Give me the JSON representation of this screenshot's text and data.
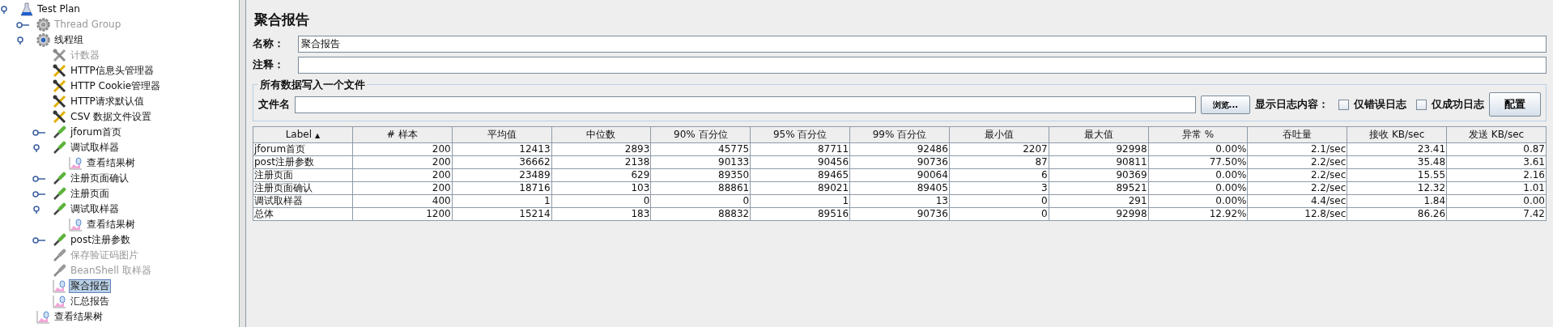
{
  "tree": [
    {
      "label": "Test Plan",
      "kind": "plan",
      "disabled": false,
      "selected": false,
      "expanded": true,
      "children": [
        {
          "label": "Thread Group",
          "kind": "threads",
          "disabled": true,
          "selected": false,
          "expanded": false
        },
        {
          "label": "线程组",
          "kind": "threads",
          "disabled": false,
          "selected": false,
          "expanded": true,
          "children": [
            {
              "label": "计数器",
              "kind": "config",
              "disabled": true,
              "selected": false
            },
            {
              "label": "HTTP信息头管理器",
              "kind": "config",
              "disabled": false,
              "selected": false
            },
            {
              "label": "HTTP Cookie管理器",
              "kind": "config",
              "disabled": false,
              "selected": false
            },
            {
              "label": "HTTP请求默认值",
              "kind": "config",
              "disabled": false,
              "selected": false
            },
            {
              "label": "CSV 数据文件设置",
              "kind": "config",
              "disabled": false,
              "selected": false
            },
            {
              "label": "jforum首页",
              "kind": "sampler",
              "disabled": false,
              "selected": false,
              "expanded": false
            },
            {
              "label": "调试取样器",
              "kind": "sampler",
              "disabled": false,
              "selected": false,
              "expanded": true,
              "children": [
                {
                  "label": "查看结果树",
                  "kind": "listener",
                  "disabled": false,
                  "selected": false
                }
              ]
            },
            {
              "label": "注册页面确认",
              "kind": "sampler",
              "disabled": false,
              "selected": false,
              "expanded": false
            },
            {
              "label": "注册页面",
              "kind": "sampler",
              "disabled": false,
              "selected": false,
              "expanded": false
            },
            {
              "label": "调试取样器",
              "kind": "sampler",
              "disabled": false,
              "selected": false,
              "expanded": true,
              "children": [
                {
                  "label": "查看结果树",
                  "kind": "listener",
                  "disabled": false,
                  "selected": false
                }
              ]
            },
            {
              "label": "post注册参数",
              "kind": "sampler",
              "disabled": false,
              "selected": false,
              "expanded": false
            },
            {
              "label": "保存验证码图片",
              "kind": "sampler",
              "disabled": true,
              "selected": false
            },
            {
              "label": "BeanShell 取样器",
              "kind": "sampler",
              "disabled": true,
              "selected": false
            },
            {
              "label": "聚合报告",
              "kind": "listener",
              "disabled": false,
              "selected": true
            },
            {
              "label": "汇总报告",
              "kind": "listener",
              "disabled": false,
              "selected": false
            }
          ]
        },
        {
          "label": "查看结果树",
          "kind": "listener",
          "disabled": false,
          "selected": false
        }
      ]
    }
  ],
  "panel": {
    "title": "聚合报告",
    "name_label": "名称：",
    "name_value": "聚合报告",
    "comment_label": "注释：",
    "file_group": {
      "legend": "所有数据写入一个文件",
      "file_label": "文件名",
      "browse_button": "浏览...",
      "log_label": "显示日志内容：",
      "checkboxes": [
        {
          "label": "仅错误日志",
          "checked": false
        },
        {
          "label": "仅成功日志",
          "checked": false
        }
      ],
      "config_button": "配置"
    }
  },
  "table": {
    "columns": [
      {
        "label": "Label",
        "sort_mark": "▲"
      },
      {
        "label": "# 样本"
      },
      {
        "label": "平均值"
      },
      {
        "label": "中位数"
      },
      {
        "label": "90% 百分位"
      },
      {
        "label": "95% 百分位"
      },
      {
        "label": "99% 百分位"
      },
      {
        "label": "最小值"
      },
      {
        "label": "最大值"
      },
      {
        "label": "异常 %"
      },
      {
        "label": "吞吐量"
      },
      {
        "label": "接收 KB/sec"
      },
      {
        "label": "发送 KB/sec"
      }
    ],
    "rows": [
      [
        "jforum首页",
        "200",
        "12413",
        "2893",
        "45775",
        "87711",
        "92486",
        "2207",
        "92998",
        "0.00%",
        "2.1/sec",
        "23.41",
        "0.87"
      ],
      [
        "post注册参数",
        "200",
        "36662",
        "2138",
        "90133",
        "90456",
        "90736",
        "87",
        "90811",
        "77.50%",
        "2.2/sec",
        "35.48",
        "3.61"
      ],
      [
        "注册页面",
        "200",
        "23489",
        "629",
        "89350",
        "89465",
        "90064",
        "6",
        "90369",
        "0.00%",
        "2.2/sec",
        "15.55",
        "2.16"
      ],
      [
        "注册页面确认",
        "200",
        "18716",
        "103",
        "88861",
        "89021",
        "89405",
        "3",
        "89521",
        "0.00%",
        "2.2/sec",
        "12.32",
        "1.01"
      ],
      [
        "调试取样器",
        "400",
        "1",
        "0",
        "0",
        "1",
        "13",
        "0",
        "291",
        "0.00%",
        "4.4/sec",
        "1.84",
        "0.00"
      ],
      [
        "总体",
        "1200",
        "15214",
        "183",
        "88832",
        "89516",
        "90736",
        "0",
        "92998",
        "12.92%",
        "12.8/sec",
        "86.26",
        "7.42"
      ]
    ]
  }
}
